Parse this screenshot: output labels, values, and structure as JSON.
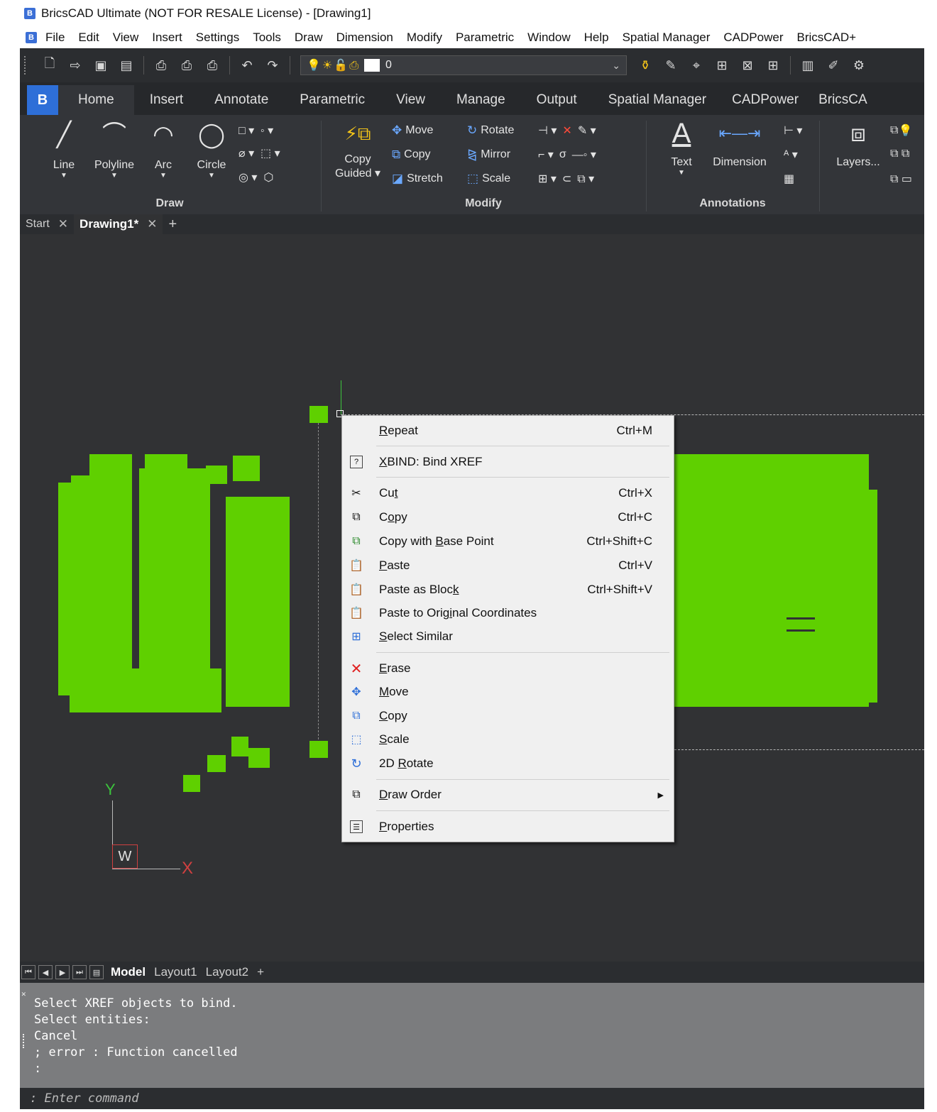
{
  "window": {
    "title": "BricsCAD Ultimate (NOT FOR RESALE License) - [Drawing1]"
  },
  "menu": [
    "File",
    "Edit",
    "View",
    "Insert",
    "Settings",
    "Tools",
    "Draw",
    "Dimension",
    "Modify",
    "Parametric",
    "Window",
    "Help",
    "Spatial Manager",
    "CADPower",
    "BricsCAD+"
  ],
  "toolbar": {
    "layer_name": "0"
  },
  "ribbon_tabs": [
    "Home",
    "Insert",
    "Annotate",
    "Parametric",
    "View",
    "Manage",
    "Output",
    "Spatial Manager",
    "CADPower",
    "BricsCA"
  ],
  "ribbon": {
    "draw": {
      "label": "Draw",
      "line": "Line",
      "polyline": "Polyline",
      "arc": "Arc",
      "circle": "Circle"
    },
    "modify": {
      "label": "Modify",
      "copy_guided_1": "Copy",
      "copy_guided_2": "Guided",
      "move": "Move",
      "copy": "Copy",
      "stretch": "Stretch",
      "rotate": "Rotate",
      "mirror": "Mirror",
      "scale": "Scale"
    },
    "annotations": {
      "label": "Annotations",
      "text": "Text",
      "dimension": "Dimension"
    },
    "layers": {
      "label": "Layers..."
    }
  },
  "doc_tabs": {
    "start": "Start",
    "drawing": "Drawing1*",
    "add": "+"
  },
  "ucs": {
    "y": "Y",
    "x": "X",
    "w": "W"
  },
  "context_menu": {
    "repeat": {
      "label": "Repeat",
      "shortcut": "Ctrl+M"
    },
    "xbind": {
      "label": "XBIND: Bind XREF"
    },
    "cut": {
      "label": "Cut",
      "shortcut": "Ctrl+X"
    },
    "copy": {
      "label": "Copy",
      "shortcut": "Ctrl+C"
    },
    "copy_base": {
      "label": "Copy with Base Point",
      "shortcut": "Ctrl+Shift+C"
    },
    "paste": {
      "label": "Paste",
      "shortcut": "Ctrl+V"
    },
    "paste_block": {
      "label": "Paste as Block",
      "shortcut": "Ctrl+Shift+V"
    },
    "paste_orig": {
      "label": "Paste to Original Coordinates"
    },
    "select_similar": {
      "label": "Select Similar"
    },
    "erase": {
      "label": "Erase"
    },
    "move": {
      "label": "Move"
    },
    "copy2": {
      "label": "Copy"
    },
    "scale": {
      "label": "Scale"
    },
    "rotate2d": {
      "label": "2D Rotate"
    },
    "draw_order": {
      "label": "Draw Order"
    },
    "properties": {
      "label": "Properties"
    }
  },
  "layout_tabs": {
    "model": "Model",
    "layout1": "Layout1",
    "layout2": "Layout2",
    "add": "+"
  },
  "command": {
    "history": [
      "Select XREF objects to bind.",
      "Select entities:",
      "Cancel",
      "; error : Function cancelled",
      ":"
    ],
    "prompt": ": Enter command"
  }
}
